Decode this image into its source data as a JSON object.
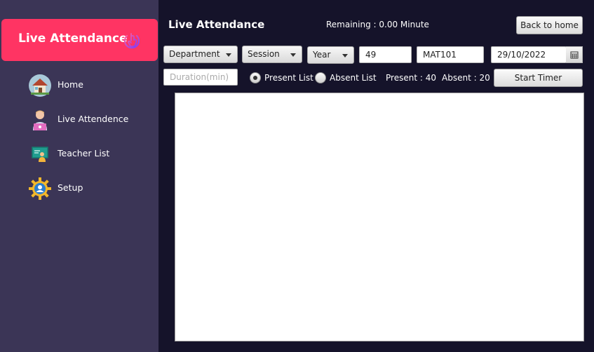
{
  "sidebar": {
    "brand_title": "Live Attendance",
    "brand_icon": "power-touch-icon",
    "items": [
      {
        "label": "Home",
        "icon": "home-icon"
      },
      {
        "label": "Live Attendence",
        "icon": "teacher-laptop-icon"
      },
      {
        "label": "Teacher List",
        "icon": "teacher-board-icon"
      },
      {
        "label": "Setup",
        "icon": "gear-user-icon"
      }
    ]
  },
  "header": {
    "title": "Live Attendance",
    "remaining": "Remaining : 0.00 Minute",
    "back_button": "Back to home"
  },
  "filters": {
    "department": "Department",
    "session": "Session",
    "year": "Year",
    "number": "49",
    "course": "MAT101",
    "date": "29/10/2022",
    "duration_placeholder": "Duration(min)"
  },
  "options": {
    "present_list": "Present List",
    "absent_list": "Absent List",
    "selected": "present"
  },
  "stats": {
    "present": "Present  : 40",
    "absent": "Absent : 20"
  },
  "actions": {
    "start_timer": "Start Timer"
  },
  "colors": {
    "brand": "#ff3463",
    "sidebar": "#3b3556",
    "background": "#15132a"
  }
}
